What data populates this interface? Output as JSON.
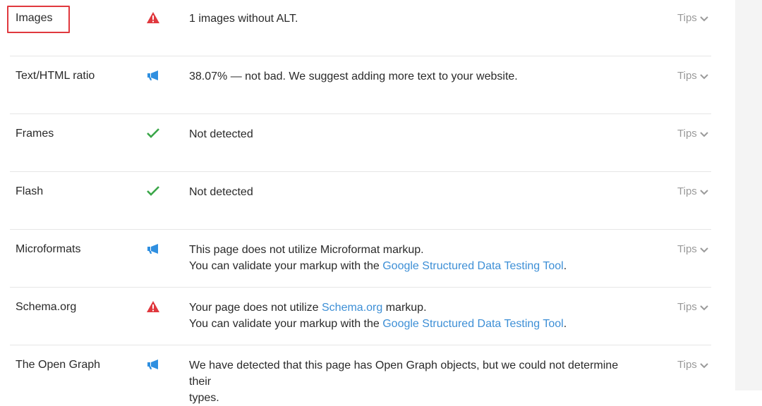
{
  "rows": [
    {
      "label": "Images",
      "status": "warning-icon",
      "lines": [
        "1 images without ALT."
      ],
      "tips": "Tips"
    },
    {
      "label": "Text/HTML ratio",
      "status": "megaphone-icon",
      "lines": [
        "38.07% — not bad. We suggest adding more text to your website."
      ],
      "tips": "Tips"
    },
    {
      "label": "Frames",
      "status": "check-icon",
      "lines": [
        "Not detected"
      ],
      "tips": "Tips"
    },
    {
      "label": "Flash",
      "status": "check-icon",
      "lines": [
        "Not detected"
      ],
      "tips": "Tips"
    },
    {
      "label": "Microformats",
      "status": "megaphone-icon",
      "line1": "This page does not utilize Microformat markup.",
      "line2_pre": "You can validate your markup with the ",
      "line2_link": "Google Structured Data Testing Tool",
      "line2_post": ".",
      "tips": "Tips"
    },
    {
      "label": "Schema.org",
      "status": "warning-icon",
      "line1_pre": "Your page does not utilize ",
      "line1_link": "Schema.org",
      "line1_post": " markup.",
      "line2_pre": "You can validate your markup with the ",
      "line2_link": "Google Structured Data Testing Tool",
      "line2_post": ".",
      "tips": "Tips"
    },
    {
      "label": "The Open Graph",
      "status": "megaphone-icon",
      "line1": "We have detected that this page has Open Graph objects, but we could not determine their",
      "line2": "types.",
      "tips": "Tips"
    }
  ],
  "colors": {
    "warning": "#e0383e",
    "info": "#2f8fe0",
    "ok": "#3aa648",
    "link": "#3d8fd6",
    "highlight": "#e0383e"
  }
}
